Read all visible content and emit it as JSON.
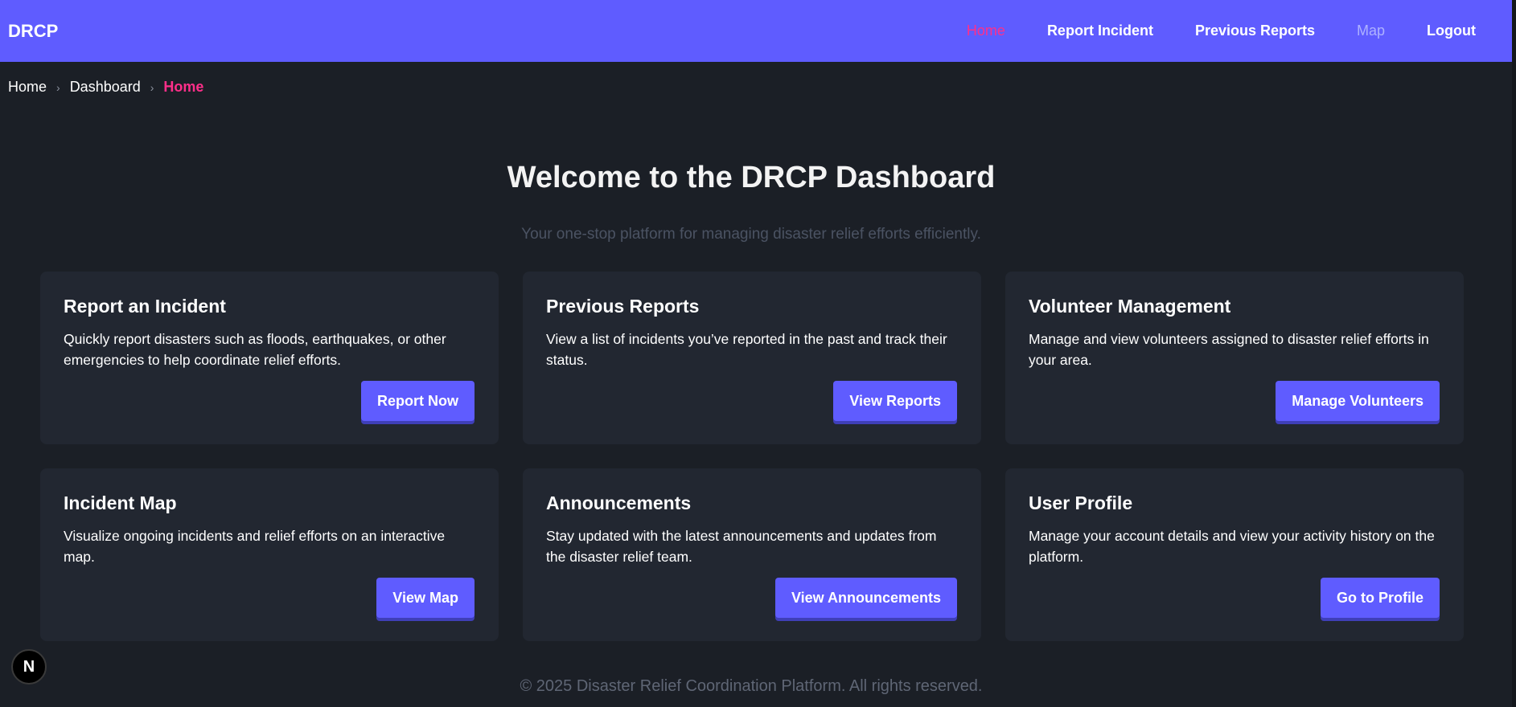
{
  "navbar": {
    "brand": "DRCP",
    "links": [
      {
        "label": "Home",
        "state": "active"
      },
      {
        "label": "Report Incident",
        "state": "normal"
      },
      {
        "label": "Previous Reports",
        "state": "normal"
      },
      {
        "label": "Map",
        "state": "muted"
      },
      {
        "label": "Logout",
        "state": "normal"
      }
    ]
  },
  "breadcrumb": {
    "items": [
      "Home",
      "Dashboard",
      "Home"
    ],
    "separator": "›"
  },
  "hero": {
    "title": "Welcome to the DRCP Dashboard",
    "subtitle": "Your one-stop platform for managing disaster relief efforts efficiently."
  },
  "cards": [
    {
      "title": "Report an Incident",
      "description": "Quickly report disasters such as floods, earthquakes, or other emergencies to help coordinate relief efforts.",
      "button": "Report Now"
    },
    {
      "title": "Previous Reports",
      "description": "View a list of incidents you’ve reported in the past and track their status.",
      "button": "View Reports"
    },
    {
      "title": "Volunteer Management",
      "description": "Manage and view volunteers assigned to disaster relief efforts in your area.",
      "button": "Manage Volunteers"
    },
    {
      "title": "Incident Map",
      "description": "Visualize ongoing incidents and relief efforts on an interactive map.",
      "button": "View Map"
    },
    {
      "title": "Announcements",
      "description": "Stay updated with the latest announcements and updates from the disaster relief team.",
      "button": "View Announcements"
    },
    {
      "title": "User Profile",
      "description": "Manage your account details and view your activity history on the platform.",
      "button": "Go to Profile"
    }
  ],
  "footer": {
    "text": "© 2025 Disaster Relief Coordination Platform. All rights reserved."
  },
  "badge": {
    "letter": "N",
    "icon": "nextjs-icon"
  },
  "colors": {
    "accent": "#5f5cff",
    "active_link": "#ff2f8a",
    "background": "#1b1f26",
    "card": "#222731"
  }
}
